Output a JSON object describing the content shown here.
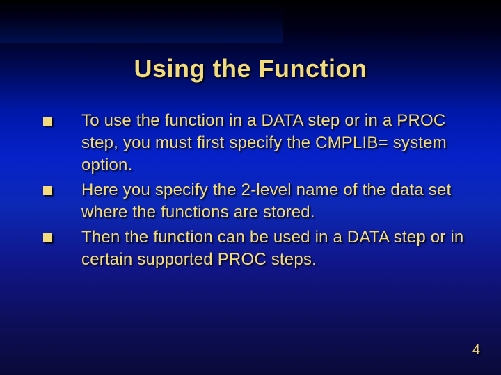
{
  "title": "Using the Function",
  "bullets": [
    "To use the function in a DATA step or in a PROC step, you must first specify the CMPLIB= system option.",
    "Here you specify the 2-level name of the data set where the functions are stored.",
    "Then the function can be used in a DATA step or in certain supported PROC steps."
  ],
  "page_number": "4"
}
